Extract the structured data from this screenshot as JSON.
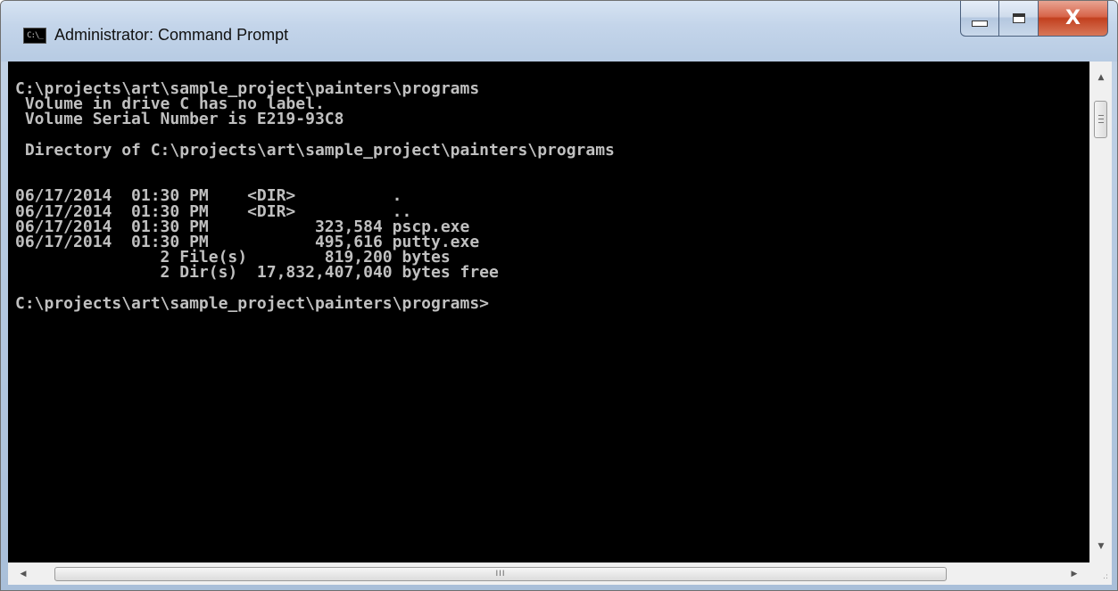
{
  "window": {
    "title": "Administrator: Command Prompt",
    "icon_label": "C:\\_"
  },
  "caption_buttons": {
    "minimize_icon": "minimize-icon",
    "maximize_icon": "maximize-icon",
    "close_label": "X"
  },
  "console": {
    "lines": [
      "C:\\projects\\art\\sample_project\\painters\\programs",
      " Volume in drive C has no label.",
      " Volume Serial Number is E219-93C8",
      "",
      " Directory of C:\\projects\\art\\sample_project\\painters\\programs",
      "",
      "",
      "06/17/2014  01:30 PM    <DIR>          .",
      "06/17/2014  01:30 PM    <DIR>          ..",
      "06/17/2014  01:30 PM           323,584 pscp.exe",
      "06/17/2014  01:30 PM           495,616 putty.exe",
      "               2 File(s)        819,200 bytes",
      "               2 Dir(s)  17,832,407,040 bytes free",
      "",
      "C:\\projects\\art\\sample_project\\painters\\programs>"
    ]
  },
  "scrollbars": {
    "vertical_up": "▲",
    "vertical_down": "▼",
    "horizontal_left": "◀",
    "horizontal_right": "▶",
    "horizontal_grip": "III",
    "resize_grip": ".:"
  },
  "colors": {
    "console_bg": "#000000",
    "console_fg": "#c0c0c0",
    "close_button": "#c2401f"
  }
}
